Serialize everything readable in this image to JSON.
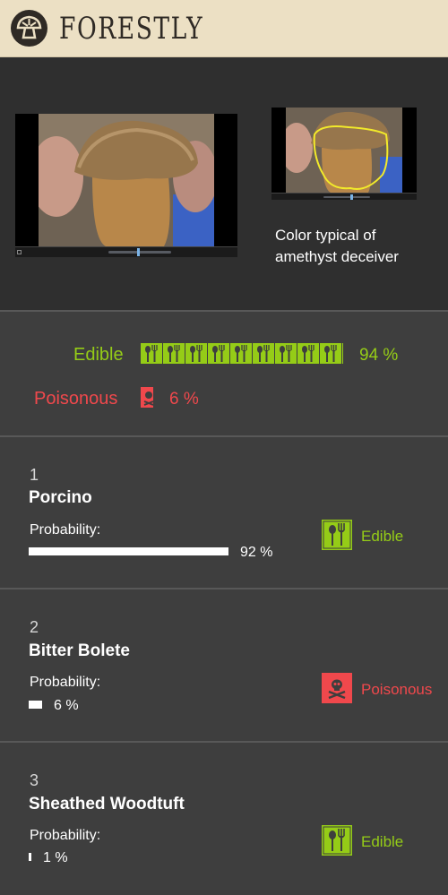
{
  "header": {
    "brand": "FORESTLY",
    "logo_icon": "mushroom-logo-icon"
  },
  "media": {
    "main_player": {
      "image": "mushroom-photo",
      "controls": [
        "stop-button",
        "seek-slider"
      ]
    },
    "thumb_player": {
      "image": "mushroom-photo-highlighted",
      "controls": [
        "seek-slider"
      ]
    },
    "caption": "Color typical of amethyst deceiver"
  },
  "summary": {
    "edible_label": "Edible",
    "edible_value": "94 %",
    "edible_fraction": 0.94,
    "poisonous_label": "Poisonous",
    "poisonous_value": "6 %",
    "poisonous_fraction": 0.06
  },
  "results": [
    {
      "rank": "1",
      "name": "Porcino",
      "probability_label": "Probability:",
      "probability_value": "92 %",
      "probability": 0.92,
      "class_label": "Edible",
      "class": "edible",
      "icon": "cutlery-icon"
    },
    {
      "rank": "2",
      "name": "Bitter Bolete",
      "probability_label": "Probability:",
      "probability_value": "6 %",
      "probability": 0.06,
      "class_label": "Poisonous",
      "class": "poisonous",
      "icon": "skull-icon"
    },
    {
      "rank": "3",
      "name": "Sheathed Woodtuft",
      "probability_label": "Probability:",
      "probability_value": "1 %",
      "probability": 0.01,
      "class_label": "Edible",
      "class": "edible",
      "icon": "cutlery-icon"
    }
  ],
  "colors": {
    "edible": "#95cc17",
    "poisonous": "#f0484c",
    "header_bg": "#ece0c4",
    "panel_bg": "#3e3e3e",
    "media_bg": "#2f2f2f"
  }
}
